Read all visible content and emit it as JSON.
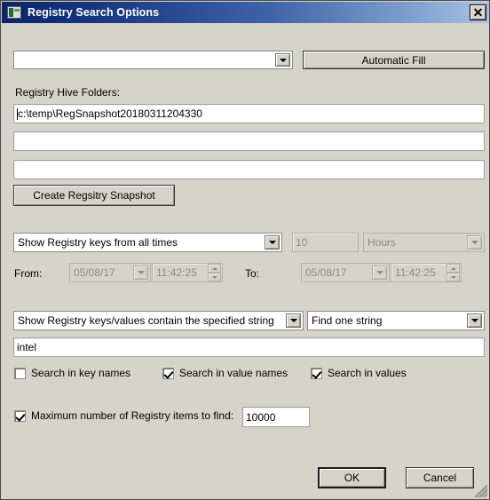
{
  "window": {
    "title": "Registry Search Options",
    "icon": "registry-window-icon",
    "close_label": "✕"
  },
  "top": {
    "hive_combo_value": "",
    "automatic_fill_label": "Automatic Fill"
  },
  "hive": {
    "section_label": "Registry Hive Folders:",
    "folder1": "c:\\temp\\RegSnapshot20180311204330",
    "folder2": "",
    "folder3": "",
    "create_snapshot_label": "Create Regsitry Snapshot"
  },
  "time": {
    "mode_value": "Show Registry keys from all times",
    "amount_value": "10",
    "unit_value": "Hours",
    "from_label": "From:",
    "from_date": "05/08/17",
    "from_time": "11:42:25",
    "to_label": "To:",
    "to_date": "05/08/17",
    "to_time": "11:42:25"
  },
  "search": {
    "match_mode_value": "Show Registry keys/values contain the specified string",
    "find_mode_value": "Find one string",
    "query_value": "intel",
    "checkboxes": [
      {
        "label": "Search in key names",
        "checked": false
      },
      {
        "label": "Search in value names",
        "checked": true
      },
      {
        "label": "Search in values",
        "checked": true
      }
    ]
  },
  "limit": {
    "label": "Maximum number of Registry items to find:",
    "checked": true,
    "value": "10000"
  },
  "footer": {
    "ok_label": "OK",
    "cancel_label": "Cancel"
  },
  "colors": {
    "titlebar_start": "#0a246a",
    "titlebar_end": "#a9c2e3",
    "dialog_face": "#d6d3cb",
    "field_bg": "#ffffff",
    "disabled_text": "#8a8a84"
  }
}
